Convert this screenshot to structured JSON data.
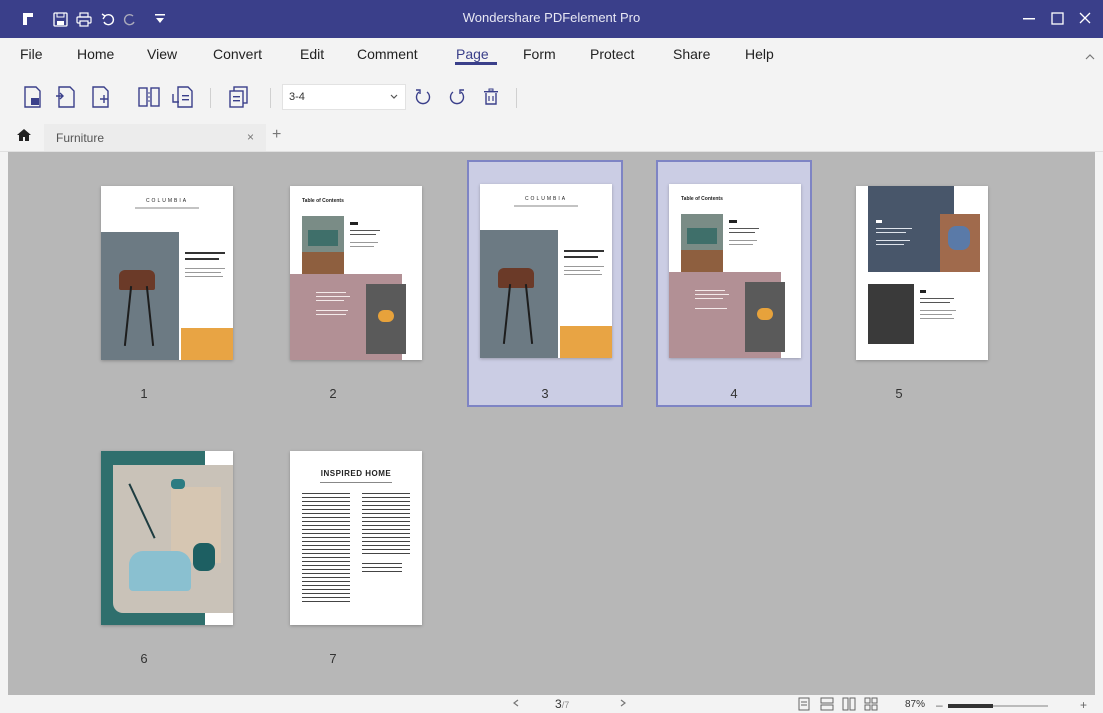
{
  "window": {
    "title": "Wondershare PDFelement Pro"
  },
  "menu": {
    "items": [
      "File",
      "Home",
      "View",
      "Convert",
      "Edit",
      "Comment",
      "Page",
      "Form",
      "Protect",
      "Share",
      "Help"
    ],
    "active": "Page"
  },
  "toolbar": {
    "page_range": "3-4",
    "buttons": [
      "extract-pages-icon",
      "insert-pages-icon",
      "insert-blank-icon",
      "split-icon",
      "replace-icon",
      "crop-icon",
      "rotate-left-icon",
      "rotate-right-icon",
      "delete-icon"
    ]
  },
  "tabs": [
    {
      "label": "Furniture",
      "close": "×"
    }
  ],
  "tab_add": "+",
  "pages": [
    {
      "number": "1",
      "selected": false,
      "heading": "COLUMBIA",
      "kind": "cover"
    },
    {
      "number": "2",
      "selected": false,
      "heading": "Table of Contents",
      "kind": "toc"
    },
    {
      "number": "3",
      "selected": true,
      "heading": "COLUMBIA",
      "kind": "cover"
    },
    {
      "number": "4",
      "selected": true,
      "heading": "Table of Contents",
      "kind": "toc"
    },
    {
      "number": "5",
      "selected": false,
      "heading": "",
      "kind": "feature"
    },
    {
      "number": "6",
      "selected": false,
      "heading": "",
      "kind": "photo"
    },
    {
      "number": "7",
      "selected": false,
      "heading": "INSPIRED HOME",
      "kind": "article"
    }
  ],
  "status": {
    "current_page": "3",
    "total_pages": "/7",
    "zoom": "87%",
    "zoom_level": 0.45
  },
  "colors": {
    "accent": "#3a3f8a",
    "canvas": "#b7b7b7",
    "selection": "#cbcee6"
  }
}
